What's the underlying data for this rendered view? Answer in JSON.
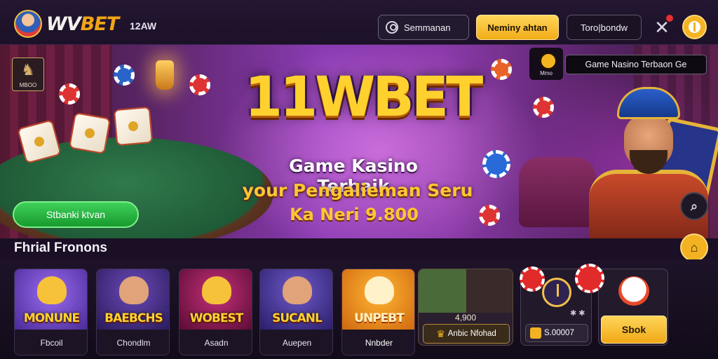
{
  "header": {
    "logo_text_main": "WV",
    "logo_text_accent": "BET",
    "time": "12AW",
    "search_label": "Semmanan",
    "login_label": "Neminy ahtan",
    "register_label": "Toro|bondw",
    "tools_icon": "wrench-cross-icon",
    "menu_icon": "clover-menu-icon"
  },
  "hero": {
    "badge_text": "MBOO",
    "title": "11WBET",
    "line1": "Game Kasino Terbaik",
    "line2": "your Pengalieman Seru",
    "line3": "Ka Neri 9.800",
    "cta_label": "Stbanki ktvan",
    "info_icon_text": "Mmo",
    "tooltip": "Game Nasino Terbaon Ge"
  },
  "section": {
    "title": "Fhrial Fronons"
  },
  "games": [
    {
      "art": "MONUNE",
      "label": "Fbcoil"
    },
    {
      "art": "BAEBCHS",
      "label": "Chondlm"
    },
    {
      "art": "WOBEST",
      "label": "Asadn"
    },
    {
      "art": "SUCANL",
      "label": "Auepen"
    },
    {
      "art": "UNPEBT",
      "label": "Nnbder"
    }
  ],
  "promo": {
    "amount": "4,900",
    "button_label": "Anbic Nfohad"
  },
  "wheel": {
    "symbols": "✱ ✱",
    "button_label": "S.00007"
  },
  "gift": {
    "button_label": "Sbok"
  },
  "colors": {
    "accent_gold": "#f2ad17",
    "cta_green": "#179a2e",
    "background": "#1a0f24"
  }
}
